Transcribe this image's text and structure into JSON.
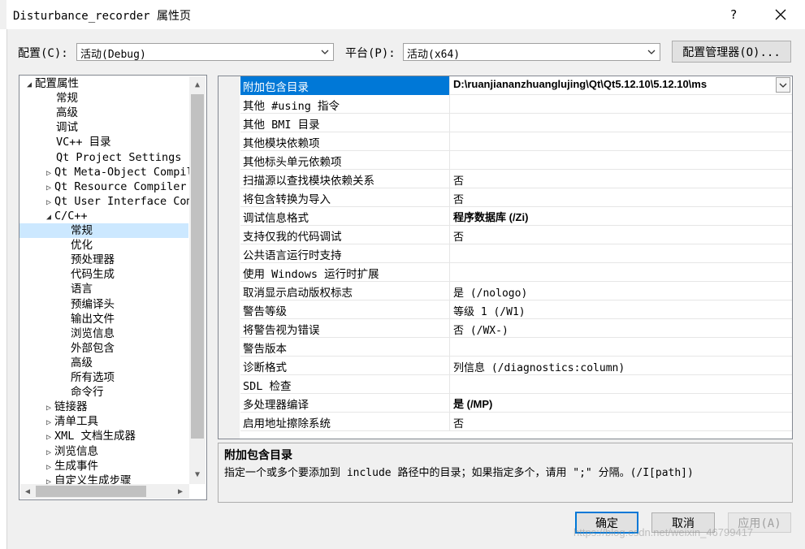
{
  "window": {
    "title": "Disturbance_recorder 属性页",
    "help_label": "?"
  },
  "config": {
    "label": "配置(C):",
    "value": "活动(Debug)",
    "platform_label": "平台(P):",
    "platform_value": "活动(x64)",
    "manager_button": "配置管理器(O)..."
  },
  "tree": {
    "items": [
      {
        "label": "配置属性",
        "expander": "◢"
      },
      {
        "label": "常规"
      },
      {
        "label": "高级"
      },
      {
        "label": "调试"
      },
      {
        "label": "VC++ 目录"
      },
      {
        "label": "Qt Project Settings"
      },
      {
        "label": "Qt Meta-Object Compil",
        "expander": "▷"
      },
      {
        "label": "Qt Resource Compiler",
        "expander": "▷"
      },
      {
        "label": "Qt User Interface Com",
        "expander": "▷"
      },
      {
        "label": "C/C++",
        "expander": "◢"
      },
      {
        "label": "常规"
      },
      {
        "label": "优化"
      },
      {
        "label": "预处理器"
      },
      {
        "label": "代码生成"
      },
      {
        "label": "语言"
      },
      {
        "label": "预编译头"
      },
      {
        "label": "输出文件"
      },
      {
        "label": "浏览信息"
      },
      {
        "label": "外部包含"
      },
      {
        "label": "高级"
      },
      {
        "label": "所有选项"
      },
      {
        "label": "命令行"
      },
      {
        "label": "链接器",
        "expander": "▷"
      },
      {
        "label": "清单工具",
        "expander": "▷"
      },
      {
        "label": "XML 文档生成器",
        "expander": "▷"
      },
      {
        "label": "浏览信息",
        "expander": "▷"
      },
      {
        "label": "生成事件",
        "expander": "▷"
      },
      {
        "label": "自定义生成步骤",
        "expander": "▷"
      }
    ],
    "selected_index": 10
  },
  "grid": {
    "rows": [
      {
        "name": "附加包含目录",
        "value": "D:\\ruanjiananzhuanglujing\\Qt\\Qt5.12.10\\5.12.10\\ms",
        "bold": true
      },
      {
        "name": "其他 #using 指令",
        "value": ""
      },
      {
        "name": "其他 BMI 目录",
        "value": ""
      },
      {
        "name": "其他模块依赖项",
        "value": ""
      },
      {
        "name": "其他标头单元依赖项",
        "value": ""
      },
      {
        "name": "扫描源以查找模块依赖关系",
        "value": "否"
      },
      {
        "name": "将包含转换为导入",
        "value": "否"
      },
      {
        "name": "调试信息格式",
        "value": "程序数据库 (/Zi)",
        "bold": true
      },
      {
        "name": "支持仅我的代码调试",
        "value": "否"
      },
      {
        "name": "公共语言运行时支持",
        "value": ""
      },
      {
        "name": "使用 Windows 运行时扩展",
        "value": ""
      },
      {
        "name": "取消显示启动版权标志",
        "value": "是 (/nologo)"
      },
      {
        "name": "警告等级",
        "value": "等级 1 (/W1)"
      },
      {
        "name": "将警告视为错误",
        "value": "否 (/WX-)"
      },
      {
        "name": "警告版本",
        "value": ""
      },
      {
        "name": "诊断格式",
        "value": "列信息 (/diagnostics:column)"
      },
      {
        "name": "SDL 检查",
        "value": ""
      },
      {
        "name": "多处理器编译",
        "value": "是 (/MP)",
        "bold": true
      },
      {
        "name": "启用地址擦除系统",
        "value": "否"
      }
    ],
    "selected_index": 0
  },
  "description": {
    "title": "附加包含目录",
    "text": "指定一个或多个要添加到 include 路径中的目录；如果指定多个，请用 \";\" 分隔。(/I[path])"
  },
  "buttons": {
    "ok": "确定",
    "cancel": "取消",
    "apply": "应用(A)"
  },
  "watermark": "https://blog.csdn.net/weixin_46799417",
  "colors": {
    "selection": "#0078d7",
    "tree_selection": "#cce8ff",
    "accent": "#0078d7"
  }
}
